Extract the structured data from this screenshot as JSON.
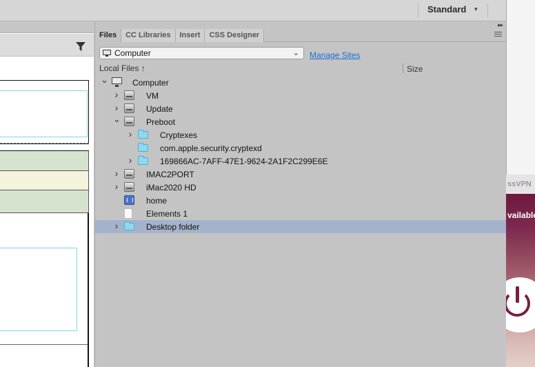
{
  "toolbar": {
    "workspace_label": "Standard"
  },
  "panel": {
    "tabs": [
      {
        "label": "Files",
        "active": true
      },
      {
        "label": "CC Libraries",
        "active": false
      },
      {
        "label": "Insert",
        "active": false
      },
      {
        "label": "CSS Designer",
        "active": false
      }
    ],
    "site_select_value": "Computer",
    "manage_sites_label": "Manage Sites",
    "columns": {
      "local_files": "Local Files",
      "size": "Size"
    },
    "tree": [
      {
        "label": "Computer",
        "icon": "computer-icon",
        "depth": 0,
        "expanded": true
      },
      {
        "label": "VM",
        "icon": "drive-icon",
        "depth": 1,
        "expanded": false
      },
      {
        "label": "Update",
        "icon": "drive-icon",
        "depth": 1,
        "expanded": false
      },
      {
        "label": "Preboot",
        "icon": "drive-icon",
        "depth": 1,
        "expanded": true
      },
      {
        "label": "Cryptexes",
        "icon": "folder-icon",
        "depth": 2,
        "expanded": false
      },
      {
        "label": "com.apple.security.cryptexd",
        "icon": "folder-icon",
        "depth": 2,
        "expanded": null
      },
      {
        "label": "169866AC-7AFF-47E1-9624-2A1F2C299E6E",
        "icon": "folder-icon",
        "depth": 2,
        "expanded": false
      },
      {
        "label": "IMAC2PORT",
        "icon": "drive-icon",
        "depth": 1,
        "expanded": false
      },
      {
        "label": "iMac2020 HD",
        "icon": "drive-icon",
        "depth": 1,
        "expanded": false
      },
      {
        "label": "home",
        "icon": "home-drive-icon",
        "depth": 1,
        "expanded": null
      },
      {
        "label": "Elements 1",
        "icon": "file-icon",
        "depth": 1,
        "expanded": null
      },
      {
        "label": "Desktop folder",
        "icon": "folder-icon",
        "depth": 1,
        "expanded": false,
        "selected": true
      }
    ]
  },
  "background_app": {
    "title_fragment": "ssVPN",
    "status_fragment": "vailable"
  },
  "colors": {
    "selection": "#a4b3cc",
    "link": "#1b6fd4",
    "vpn_accent": "#7b1b4a"
  }
}
